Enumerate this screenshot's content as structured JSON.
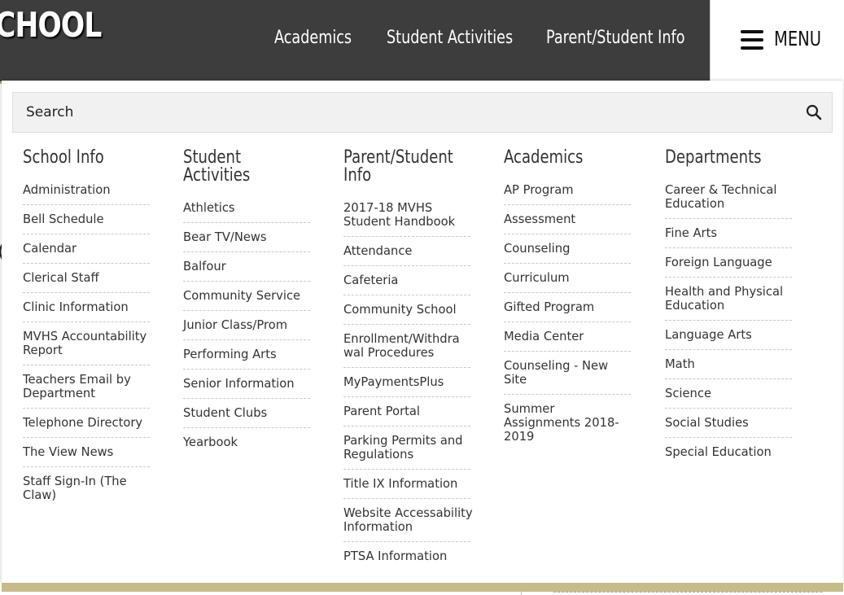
{
  "header": {
    "logo_text": "CHOOL",
    "nav": [
      "Academics",
      "Student Activities",
      "Parent/Student Info"
    ],
    "menu_label": "MENU"
  },
  "search": {
    "placeholder": "Search"
  },
  "columns": [
    {
      "title": "School Info",
      "items": [
        "Administration",
        "Bell Schedule",
        "Calendar",
        "Clerical Staff",
        "Clinic Information",
        "MVHS Accountability\nReport",
        "Teachers Email by\nDepartment",
        "Telephone Directory",
        "The View News",
        "Staff Sign-In (The\nClaw)"
      ]
    },
    {
      "title": "Student Activities",
      "items": [
        "Athletics",
        "Bear TV/News",
        "Balfour",
        "Community Service",
        "Junior Class/Prom",
        "Performing Arts",
        "Senior Information",
        "Student Clubs",
        "Yearbook"
      ]
    },
    {
      "title": "Parent/Student\nInfo",
      "items": [
        "2017-18 MVHS\nStudent Handbook",
        "Attendance",
        "Cafeteria",
        "Community School",
        "Enrollment/Withdra\nwal Procedures",
        "MyPaymentsPlus",
        "Parent Portal",
        "Parking Permits and\nRegulations",
        "Title IX Information",
        "Website Accessability\nInformation",
        "PTSA Information"
      ]
    },
    {
      "title": "Academics",
      "items": [
        "AP Program",
        "Assessment",
        "Counseling",
        "Curriculum",
        "Gifted Program",
        "Media Center",
        "Counseling - New\nSite",
        "Summer\nAssignments 2018-\n2019"
      ]
    },
    {
      "title": "Departments",
      "items": [
        "Career & Technical\nEducation",
        "Fine Arts",
        "Foreign Language",
        "Health and Physical\nEducation",
        "Language Arts",
        "Math",
        "Science",
        "Social Studies",
        "Special Education"
      ]
    }
  ],
  "colors": {
    "header_bg": "#3d3d3d",
    "accent_gold": "#c7bb8c",
    "text": "#333333"
  },
  "icons": {
    "menu": "hamburger-icon",
    "search": "search-icon"
  }
}
